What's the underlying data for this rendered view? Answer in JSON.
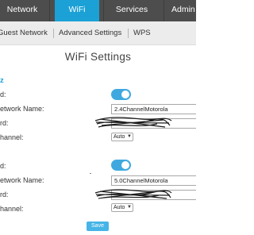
{
  "topnav": {
    "tabs": [
      {
        "label": "Network"
      },
      {
        "label": "WiFi"
      },
      {
        "label": "Services"
      },
      {
        "label": "Admin"
      }
    ],
    "active_tab": "WiFi"
  },
  "subnav": {
    "items": [
      {
        "label": "Guest Network"
      },
      {
        "label": "Advanced Settings"
      },
      {
        "label": "WPS"
      }
    ]
  },
  "page": {
    "title": "WiFi Settings"
  },
  "band_24": {
    "section_label": "z",
    "enabled_label": "d:",
    "enabled": true,
    "network_name_label": "etwork Name:",
    "network_name_value": "2.4ChannelMotorola",
    "password_label": "rd:",
    "password_value": "",
    "channel_label": "hannel:",
    "channel_value": "Auto"
  },
  "band_5": {
    "enabled_label": "d:",
    "enabled": true,
    "network_name_label": "etwork Name:",
    "network_name_value": "5.0ChannelMotorola",
    "password_label": "rd:",
    "password_value": "",
    "channel_label": "hannel:",
    "channel_value": "Auto"
  },
  "actions": {
    "save_label": "Save"
  },
  "colors": {
    "accent": "#1ba1d6",
    "topnav_bg": "#4d4d4d",
    "subnav_bg": "#ececec",
    "toggle_on": "#3fa9df",
    "save_button": "#45b4e6"
  }
}
